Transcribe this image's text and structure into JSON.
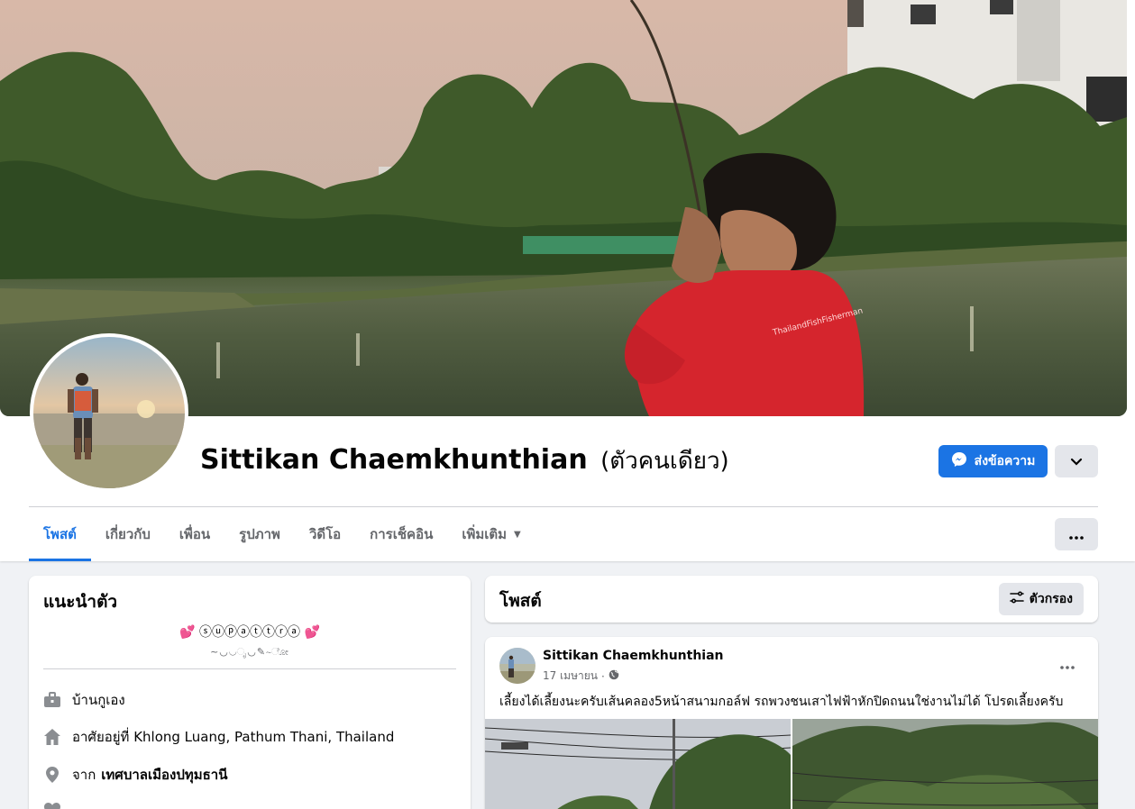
{
  "profile": {
    "name": "Sittikan Chaemkhunthian",
    "alt_name": "(ตัวคนเดียว)"
  },
  "actions": {
    "message_label": "ส่งข้อความ"
  },
  "tabs": [
    {
      "label": "โพสต์",
      "active": true
    },
    {
      "label": "เกี่ยวกับ"
    },
    {
      "label": "เพื่อน"
    },
    {
      "label": "รูปภาพ"
    },
    {
      "label": "วิดีโอ"
    },
    {
      "label": "การเช็คอิน"
    },
    {
      "label": "เพิ่มเติม"
    }
  ],
  "intro": {
    "title": "แนะนำตัว",
    "bio": "💕 ⓢⓤⓟⓐⓣⓣⓡⓐ 💕",
    "bio_sub": "~◡◡ೃ◡✎~ೋ",
    "items": [
      {
        "icon": "briefcase-icon",
        "text": "บ้านกูเอง"
      },
      {
        "icon": "home-icon",
        "text": "อาศัยอยู่ที่ Khlong Luang, Pathum Thani, Thailand"
      },
      {
        "icon": "location-pin-icon",
        "prefix": "จาก",
        "text": "เทศบาลเมืองปทุมธานี"
      }
    ]
  },
  "posts": {
    "title": "โพสต์",
    "filter_label": "ตัวกรอง",
    "items": [
      {
        "author": "Sittikan Chaemkhunthian",
        "date": "17 เมษายน",
        "privacy_icon": "globe-icon",
        "text": "เลี้ยงได้เลี้ยงนะครับเส้นคลอง5หน้าสนามกอล์ฟ รถพวงชนเสาไฟฟ้าหักปิดถนนใช่งานไม่ได้ โปรดเลี้ยงครับ"
      }
    ]
  },
  "colors": {
    "accent": "#1b74e4",
    "background": "#f0f2f5",
    "secondary_button": "#e4e6eb"
  }
}
